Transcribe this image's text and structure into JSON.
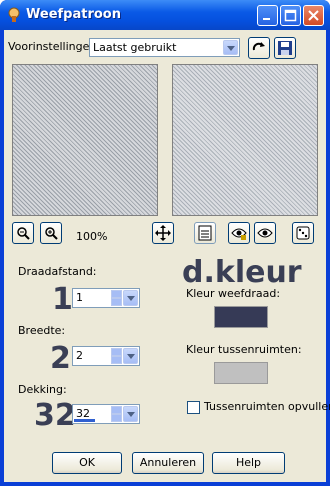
{
  "window": {
    "title": "Weefpatroon"
  },
  "presets": {
    "label": "Voorinstellingen:",
    "value": "Laatst gebruikt"
  },
  "zoom": {
    "value": "100%"
  },
  "gap": {
    "label": "Draadafstand:",
    "big_number": "1",
    "value": "1"
  },
  "width": {
    "label": "Breedte:",
    "big_number": "2",
    "value": "2"
  },
  "opacity": {
    "label": "Dekking:",
    "big_number": "32",
    "value": "32",
    "level_percent": 32
  },
  "overlay_text": "d.kleur",
  "weave_color": {
    "label": "Kleur weefdraad:",
    "color": "#363a56"
  },
  "gap_color": {
    "label": "Kleur tussenruimten:",
    "color": "#c0c0c0"
  },
  "fill_gaps": {
    "label": "Tussenruimten opvullen",
    "checked": false
  },
  "buttons": {
    "ok": "OK",
    "cancel": "Annuleren",
    "help": "Help"
  },
  "colors": {
    "title_bar": "#0a5ae6",
    "dialog_bg": "#ece9d8",
    "big_text": "#3a3f55"
  }
}
